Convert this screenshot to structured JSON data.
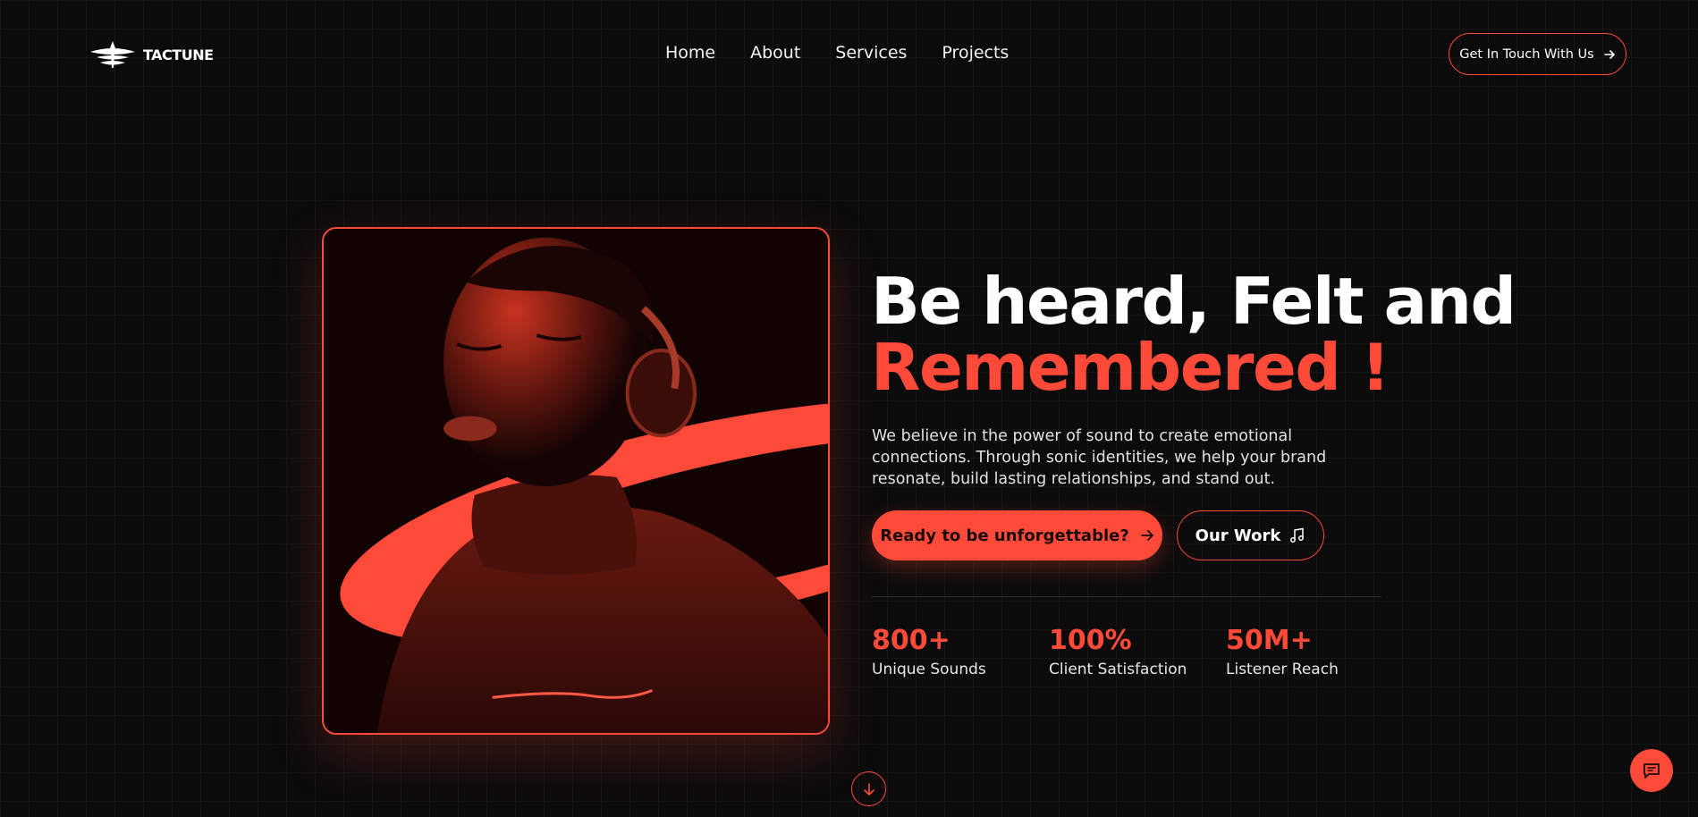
{
  "brand": {
    "name": "TACTUNE",
    "logo_icon": "tactune-logo"
  },
  "nav": [
    {
      "label": "Home"
    },
    {
      "label": "About"
    },
    {
      "label": "Services"
    },
    {
      "label": "Projects"
    }
  ],
  "header_cta": {
    "label": "Get In Touch With Us",
    "icon": "arrow-right-icon"
  },
  "hero": {
    "headline_line1": "Be heard, Felt and",
    "headline_line2": "Remembered !",
    "description": "We believe in the power of sound to create emotional connections. Through sonic identities, we help your brand resonate, build lasting relationships, and stand out.",
    "primary_button": {
      "label": "Ready to be unforgettable?",
      "icon": "arrow-right-icon"
    },
    "secondary_button": {
      "label": "Our Work",
      "icon": "music-note-icon"
    },
    "image": "person-with-headphones-photo"
  },
  "stats": [
    {
      "value": "800+",
      "label": "Unique Sounds"
    },
    {
      "value": "100%",
      "label": "Client Satisfaction"
    },
    {
      "value": "50M+",
      "label": "Listener Reach"
    }
  ],
  "scroll_button": {
    "icon": "arrow-down-icon"
  },
  "chat_button": {
    "icon": "chat-icon"
  },
  "colors": {
    "accent": "#ff4a3a",
    "background": "#0b0b0b",
    "text": "#ffffff"
  }
}
